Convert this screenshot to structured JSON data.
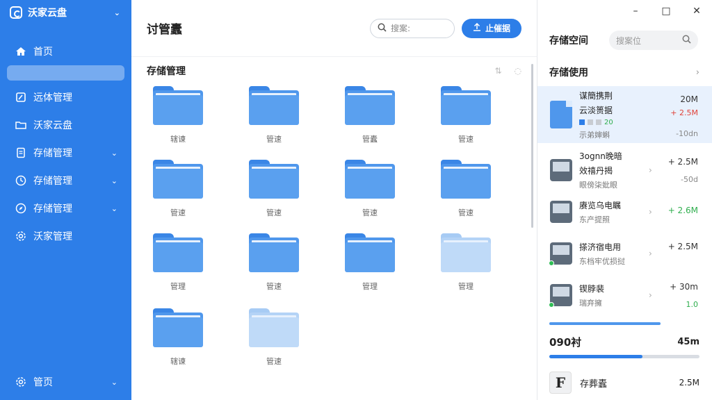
{
  "sidebar": {
    "brand": "沃家云盘",
    "items": [
      {
        "label": "首页",
        "icon": "home-icon"
      },
      {
        "label": "远体管理",
        "icon": "edit-icon"
      },
      {
        "label": "沃家云盘",
        "icon": "folder-icon"
      },
      {
        "label": "存储管理",
        "icon": "document-icon"
      },
      {
        "label": "存储管理",
        "icon": "clock-icon"
      },
      {
        "label": "存储管理",
        "icon": "compass-icon"
      },
      {
        "label": "沃家管理",
        "icon": "gear-icon"
      }
    ],
    "bottom": {
      "label": "管页",
      "icon": "gear-icon"
    }
  },
  "main": {
    "title": "讨管蠹",
    "search_placeholder": "搜案:",
    "upload_label": "止催据",
    "section_title": "存储管理",
    "folders": [
      {
        "label": "辖谏",
        "light": false
      },
      {
        "label": "管速",
        "light": false
      },
      {
        "label": "管蠹",
        "light": false
      },
      {
        "label": "管速",
        "light": false
      },
      {
        "label": "管速",
        "light": false
      },
      {
        "label": "管速",
        "light": false
      },
      {
        "label": "管速",
        "light": false
      },
      {
        "label": "管速",
        "light": false
      },
      {
        "label": "管理",
        "light": false
      },
      {
        "label": "管速",
        "light": false
      },
      {
        "label": "管理",
        "light": false
      },
      {
        "label": "管理",
        "light": true
      },
      {
        "label": "辖谏",
        "light": false
      },
      {
        "label": "管速",
        "light": true
      }
    ]
  },
  "right": {
    "title": "存储空间",
    "search_placeholder": "搜案位",
    "usage_label": "存储使用",
    "items": [
      {
        "name": "谋簡携荆",
        "sub": "云淡篑据",
        "sub2": "示弟婶蝌",
        "size": "20M",
        "size2": "+ 2.5M",
        "size3": "-10dn",
        "meta": "20"
      },
      {
        "name": "3ognn晚暗",
        "sub": "效禧丹揭",
        "sub2": "眼傍柒妣眼",
        "size": "+ 2.5M",
        "size2": "-50d"
      },
      {
        "name": "赓览乌电瞩",
        "sub": "东产提照",
        "size": "+ 2.6M"
      },
      {
        "name": "搽济宿电用",
        "sub": "东档牢优损挝",
        "size": "+ 2.5M"
      },
      {
        "name": "锲脖裴",
        "sub": "瑞弃擁",
        "size": "+ 30m",
        "size2": "1.0"
      }
    ],
    "total_label": "090衬",
    "total_value": "45m",
    "total_progress": 0.62,
    "bottom_item": {
      "name": "存葬蠹",
      "size": "2.5M",
      "icon_letter": "F"
    }
  },
  "window": {
    "minimize": "–",
    "maximize": "□",
    "close": "✕"
  }
}
